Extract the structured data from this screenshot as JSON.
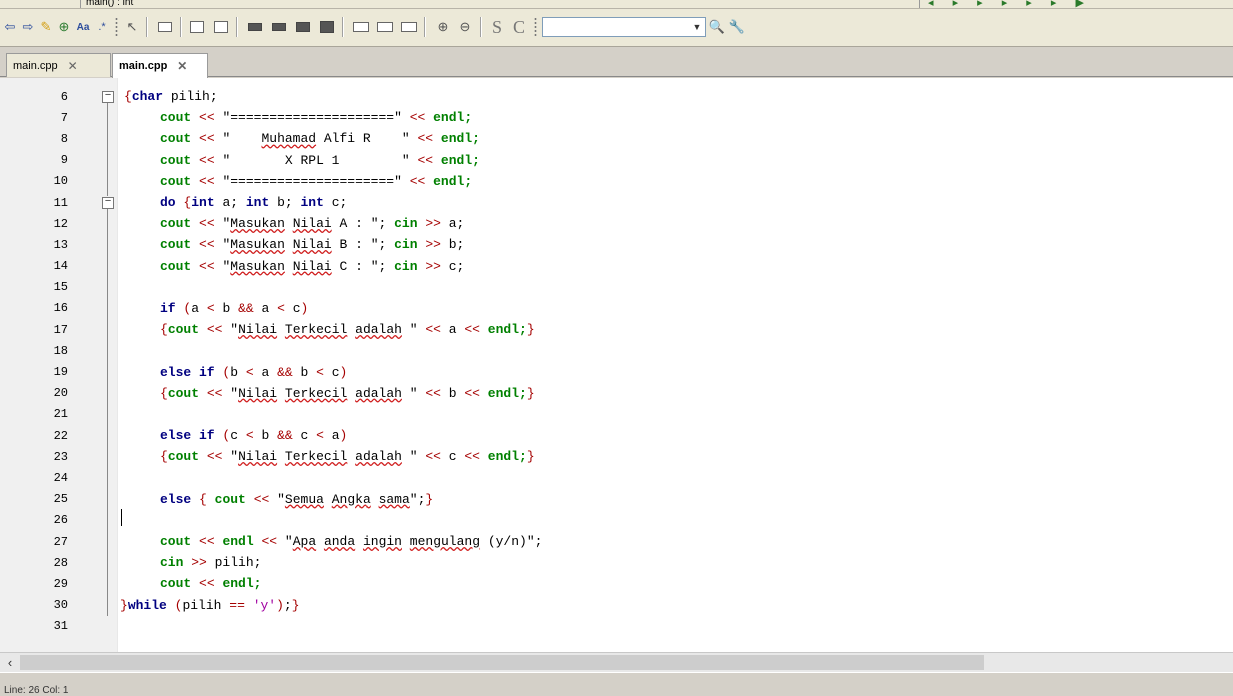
{
  "topbar": {
    "function_label": "main() : int"
  },
  "toolbar": {
    "icons": [
      "back-icon",
      "forward-icon",
      "highlight-icon",
      "toggle-bookmark-icon",
      "match-case-icon",
      "regex-icon",
      "select-icon",
      "rect-icon",
      "image-icon",
      "text-box-icon",
      "layout1-icon",
      "layout2-icon",
      "layout3-icon",
      "layout4-icon",
      "frame1-icon",
      "frame2-icon",
      "frame3-icon",
      "zoom-in-icon",
      "zoom-out-icon",
      "s-icon",
      "c-icon"
    ],
    "search_value": ""
  },
  "tabs": [
    {
      "label": "main.cpp",
      "active": false
    },
    {
      "label": "main.cpp",
      "active": true
    }
  ],
  "editor": {
    "lines": [
      {
        "num": "6",
        "text": "{char pilih;"
      },
      {
        "num": "7",
        "text": "    cout << \"=====================\" << endl;"
      },
      {
        "num": "8",
        "text": "    cout << \"    Muhamad Alfi R    \" << endl;"
      },
      {
        "num": "9",
        "text": "    cout << \"       X RPL 1        \" << endl;"
      },
      {
        "num": "10",
        "text": "    cout << \"=====================\" << endl;"
      },
      {
        "num": "11",
        "text": "    do {int a; int b; int c;"
      },
      {
        "num": "12",
        "text": "    cout << \"Masukan Nilai A : \"; cin >> a;"
      },
      {
        "num": "13",
        "text": "    cout << \"Masukan Nilai B : \"; cin >> b;"
      },
      {
        "num": "14",
        "text": "    cout << \"Masukan Nilai C : \"; cin >> c;"
      },
      {
        "num": "15",
        "text": ""
      },
      {
        "num": "16",
        "text": "    if (a < b && a < c)"
      },
      {
        "num": "17",
        "text": "    {cout << \"Nilai Terkecil adalah \" << a << endl;}"
      },
      {
        "num": "18",
        "text": ""
      },
      {
        "num": "19",
        "text": "    else if (b < a && b < c)"
      },
      {
        "num": "20",
        "text": "    {cout << \"Nilai Terkecil adalah \" << b << endl;}"
      },
      {
        "num": "21",
        "text": ""
      },
      {
        "num": "22",
        "text": "    else if (c < b && c < a)"
      },
      {
        "num": "23",
        "text": "    {cout << \"Nilai Terkecil adalah \" << c << endl;}"
      },
      {
        "num": "24",
        "text": ""
      },
      {
        "num": "25",
        "text": "    else { cout << \"Semua Angka sama\";}"
      },
      {
        "num": "26",
        "text": ""
      },
      {
        "num": "27",
        "text": "    cout << endl << \"Apa anda ingin mengulang (y/n)\";"
      },
      {
        "num": "28",
        "text": "    cin >> pilih;"
      },
      {
        "num": "29",
        "text": "    cout << endl;"
      },
      {
        "num": "30",
        "text": "}while (pilih == 'y');}"
      },
      {
        "num": "31",
        "text": ""
      }
    ]
  },
  "status": {
    "text": "Line: 26  Col: 1"
  }
}
